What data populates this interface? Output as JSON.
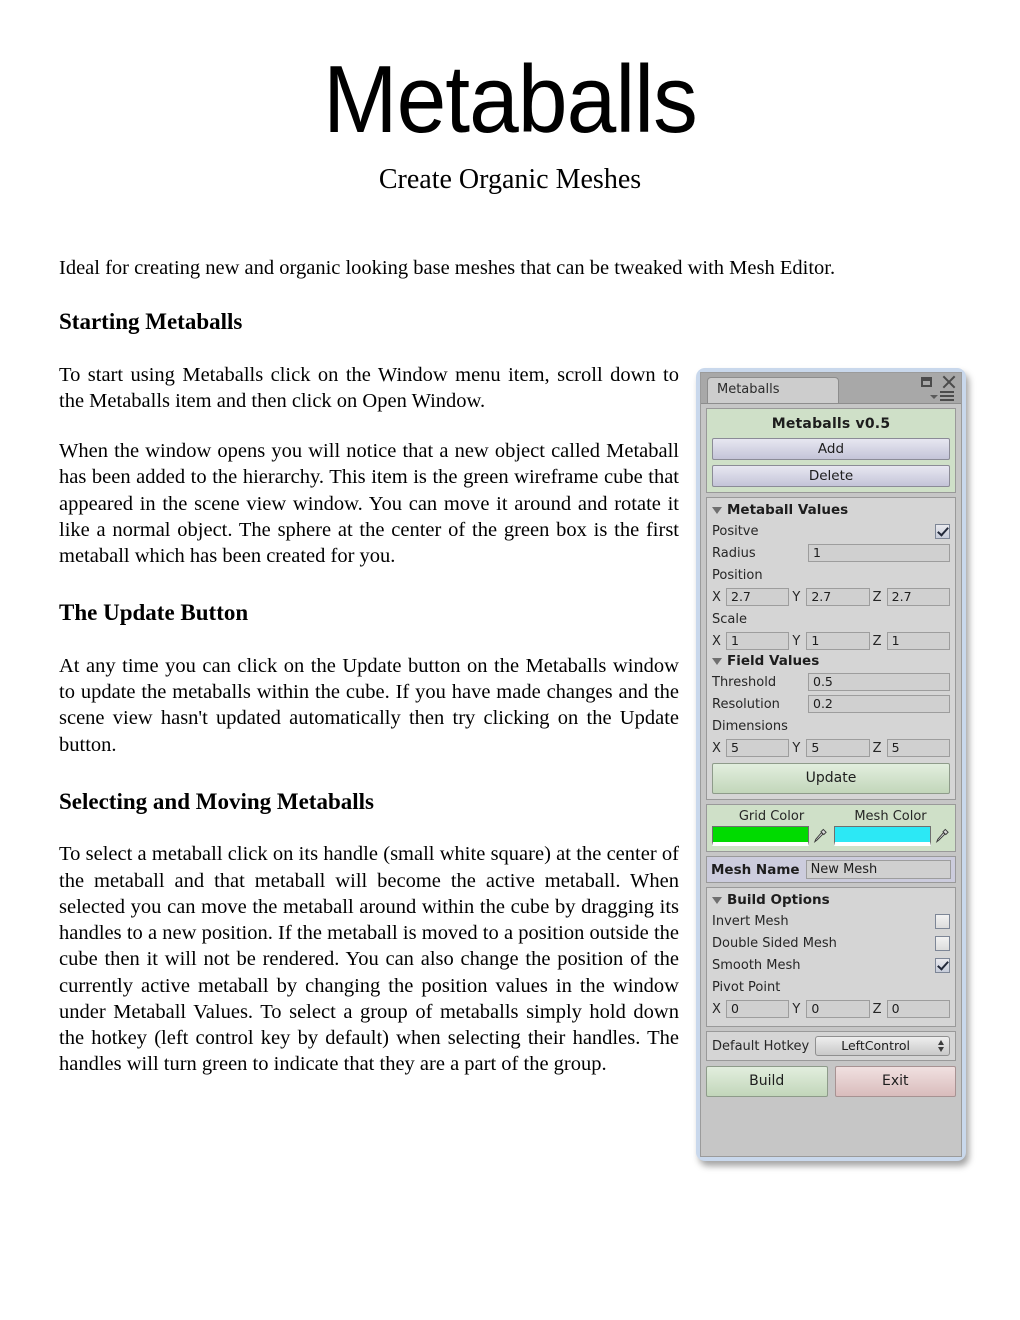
{
  "document": {
    "title": "Metaballs",
    "subtitle": "Create Organic Meshes",
    "intro": "Ideal for creating new and organic looking base meshes that can be tweaked with Mesh Editor.",
    "sections": [
      {
        "heading": "Starting Metaballs",
        "paragraphs": [
          "To start using Metaballs click on the Window menu item, scroll down to the Metaballs item and then click on Open Window.",
          "When the window opens you will notice that a new object called Metaball has been added to the hierarchy. This item is the green wireframe cube that appeared in the scene view window. You can move it around and rotate it like a normal object. The sphere at the center of the green box is the first metaball which has been created for you."
        ]
      },
      {
        "heading": "The Update Button",
        "paragraphs": [
          "At any time you can click on the Update button on the Metaballs window to update the metaballs within the cube. If you have made changes and the scene view hasn't updated automatically then try clicking on the Update button."
        ]
      },
      {
        "heading": "Selecting and Moving Metaballs",
        "paragraphs": [
          "To select a metaball click on its handle (small white square) at the center of the metaball and that metaball will become the active metaball. When selected you can move the metaball around within the cube by dragging its handles to a new position. If the metaball is moved to a position outside the cube then it will not be rendered. You can also change the position of the currently active metaball by changing  the  position values in the window under Metaball Values. To select a group of metaballs simply hold down the hotkey (left control key by default) when selecting their handles. The handles will turn green to indicate that they are a part of the group."
        ]
      }
    ]
  },
  "editor_window": {
    "tab_label": "Metaballs",
    "titlebar_icons": [
      "maximize-icon",
      "close-icon",
      "window-menu-icon"
    ],
    "header": {
      "version_title": "Metaballs v0.5",
      "add_label": "Add",
      "delete_label": "Delete"
    },
    "metaball_values": {
      "foldout_label": "Metaball Values",
      "positive_label": "Positve",
      "positive_checked": true,
      "radius_label": "Radius",
      "radius_value": "1",
      "position_label": "Position",
      "position": {
        "x_label": "X",
        "x": "2.7",
        "y_label": "Y",
        "y": "2.7",
        "z_label": "Z",
        "z": "2.7"
      },
      "scale_label": "Scale",
      "scale": {
        "x_label": "X",
        "x": "1",
        "y_label": "Y",
        "y": "1",
        "z_label": "Z",
        "z": "1"
      }
    },
    "field_values": {
      "foldout_label": "Field Values",
      "threshold_label": "Threshold",
      "threshold_value": "0.5",
      "resolution_label": "Resolution",
      "resolution_value": "0.2",
      "dimensions_label": "Dimensions",
      "dimensions": {
        "x_label": "X",
        "x": "5",
        "y_label": "Y",
        "y": "5",
        "z_label": "Z",
        "z": "5"
      },
      "update_label": "Update"
    },
    "colors": {
      "grid_color_label": "Grid Color",
      "grid_color": "#00DB00",
      "mesh_color_label": "Mesh Color",
      "mesh_color": "#2CE8F5"
    },
    "mesh_name": {
      "label": "Mesh Name",
      "value": "New Mesh"
    },
    "build_options": {
      "foldout_label": "Build Options",
      "invert_mesh_label": "Invert Mesh",
      "invert_mesh_checked": false,
      "double_sided_label": "Double Sided Mesh",
      "double_sided_checked": false,
      "smooth_mesh_label": "Smooth Mesh",
      "smooth_mesh_checked": true,
      "pivot_point_label": "Pivot Point",
      "pivot": {
        "x_label": "X",
        "x": "0",
        "y_label": "Y",
        "y": "0",
        "z_label": "Z",
        "z": "0"
      }
    },
    "hotkey": {
      "label": "Default Hotkey",
      "value": "LeftControl"
    },
    "footer": {
      "build_label": "Build",
      "exit_label": "Exit"
    }
  }
}
